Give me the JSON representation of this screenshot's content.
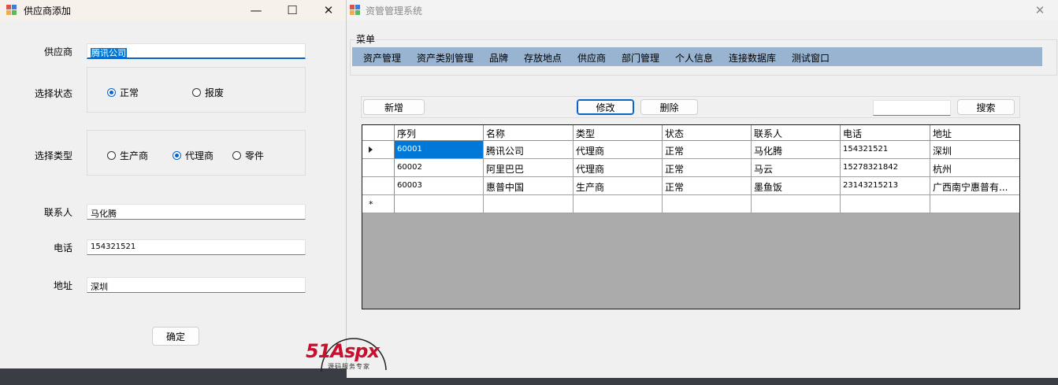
{
  "left_window": {
    "title": "供应商添加",
    "controls": {
      "minimize": "—",
      "maximize": "☐",
      "close": "✕"
    },
    "supplier_label": "供应商",
    "supplier_value": "腾讯公司",
    "status_label": "选择状态",
    "status_options": [
      "正常",
      "报废"
    ],
    "status_selected": "正常",
    "type_label": "选择类型",
    "type_options": [
      "生产商",
      "代理商",
      "零件"
    ],
    "type_selected": "代理商",
    "contact_label": "联系人",
    "contact_value": "马化腾",
    "phone_label": "电话",
    "phone_value": "154321521",
    "address_label": "地址",
    "address_value": "深圳",
    "confirm_label": "确定"
  },
  "right_window": {
    "title": "资管管理系统",
    "close": "✕",
    "menu_title": "菜单",
    "menu_items": [
      "资产管理",
      "资产类别管理",
      "品牌",
      "存放地点",
      "供应商",
      "部门管理",
      "个人信息",
      "连接数据库",
      "测试窗口"
    ],
    "toolbar": {
      "add": "新增",
      "edit": "修改",
      "delete": "删除",
      "search_value": "",
      "search": "搜索"
    },
    "grid": {
      "columns": [
        "序列",
        "名称",
        "类型",
        "状态",
        "联系人",
        "电话",
        "地址"
      ],
      "rows": [
        [
          "60001",
          "腾讯公司",
          "代理商",
          "正常",
          "马化腾",
          "154321521",
          "深圳"
        ],
        [
          "60002",
          "阿里巴巴",
          "代理商",
          "正常",
          "马云",
          "15278321842",
          "杭州"
        ],
        [
          "60003",
          "惠普中国",
          "生产商",
          "正常",
          "墨鱼饭",
          "23143215213",
          "广西南宁惠普有..."
        ]
      ],
      "new_row_marker": "*"
    }
  },
  "watermark": {
    "brand": "51Aspx",
    "tagline": "源码服务专家"
  },
  "colors": {
    "menubar": "#99b4d1",
    "accent": "#0078d7",
    "grid_empty": "#ababab",
    "watermark_red": "#c8102e",
    "watermark_green": "#2e9a3a"
  }
}
